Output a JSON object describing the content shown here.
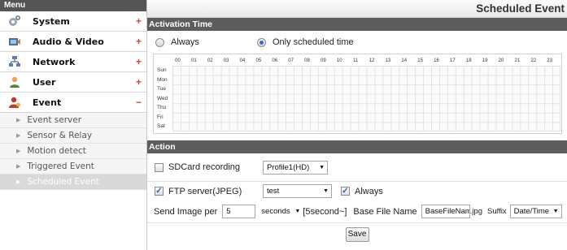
{
  "sidebar": {
    "header": "Menu",
    "items": [
      {
        "label": "System",
        "toggle": "+",
        "icon": "system-icon"
      },
      {
        "label": "Audio & Video",
        "toggle": "+",
        "icon": "audio-video-icon"
      },
      {
        "label": "Network",
        "toggle": "+",
        "icon": "network-icon"
      },
      {
        "label": "User",
        "toggle": "+",
        "icon": "user-icon"
      },
      {
        "label": "Event",
        "toggle": "−",
        "icon": "event-icon"
      }
    ],
    "event_submenu": [
      {
        "label": "Event server",
        "active": false
      },
      {
        "label": "Sensor & Relay",
        "active": false
      },
      {
        "label": "Motion detect",
        "active": false
      },
      {
        "label": "Triggered Event",
        "active": false
      },
      {
        "label": "Scheduled Event",
        "active": true
      }
    ]
  },
  "page": {
    "title": "Scheduled Event"
  },
  "activation": {
    "section_title": "Activation Time",
    "options": [
      {
        "label": "Always",
        "selected": false
      },
      {
        "label": "Only scheduled time",
        "selected": true
      }
    ],
    "hours": [
      "00",
      "01",
      "02",
      "03",
      "04",
      "05",
      "06",
      "07",
      "08",
      "09",
      "10",
      "11",
      "12",
      "13",
      "14",
      "15",
      "16",
      "17",
      "18",
      "19",
      "20",
      "21",
      "22",
      "23"
    ],
    "days": [
      "Sun",
      "Mon",
      "Tue",
      "Wed",
      "Thu",
      "Fri",
      "Sat"
    ]
  },
  "action": {
    "section_title": "Action",
    "sdcard": {
      "label": "SDCard recording",
      "checked": false,
      "profile_value": "Profile1(HD)"
    },
    "ftp": {
      "label": "FTP server(JPEG)",
      "checked": true,
      "server_value": "test",
      "always_label": "Always",
      "always_checked": true
    },
    "send": {
      "label": "Send Image per",
      "interval_value": "5",
      "unit_value": "seconds",
      "hint": "[5second~]",
      "base_label": "Base File Name",
      "base_value": "BaseFileName",
      "ext": ".jpg",
      "suffix_label": "Suffix",
      "suffix_value": "Date/Time"
    },
    "save_label": "Save"
  },
  "colors": {
    "accent_plus": "#d9432b",
    "section_bar": "#5d5d5d",
    "radio_dot": "#2b6fd6"
  }
}
